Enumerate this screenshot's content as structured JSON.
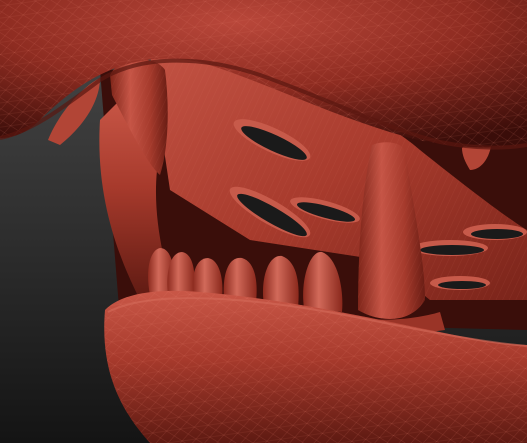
{
  "scene": {
    "subject": "sculpted-creature-mouth",
    "colors": {
      "background_top": "#484848",
      "background_bottom": "#141414",
      "flesh_base": "#a5392b",
      "flesh_light": "#c9594a",
      "flesh_dark": "#6b1f16",
      "flesh_deep": "#3e0f0b",
      "wire": "#d77062"
    },
    "counts": {
      "lower_teeth": 6,
      "palate_slots": 6
    }
  }
}
